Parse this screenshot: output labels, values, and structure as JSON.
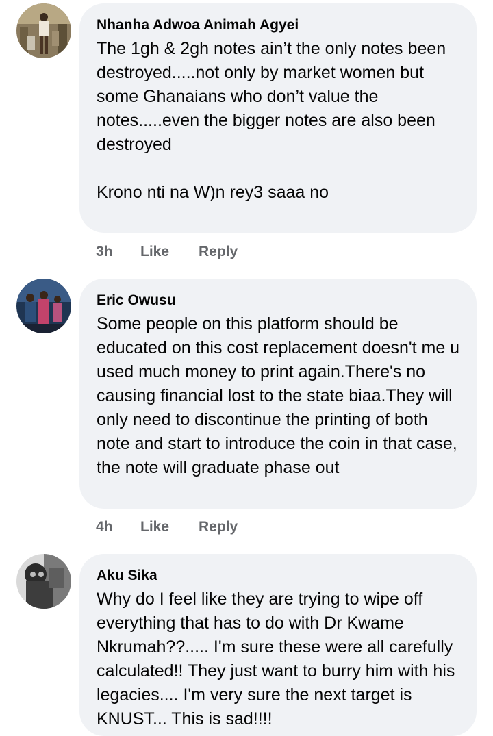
{
  "comments": [
    {
      "author": "Nhanha Adwoa Animah Agyei",
      "text": "The 1gh & 2gh notes ain’t the only notes been destroyed.....not only by market women but some Ghanaians who don’t value the notes.....even the bigger notes are also been destroyed\n\nKrono nti na W)n rey3 saaa no",
      "time": "3h",
      "like_label": "Like",
      "reply_label": "Reply"
    },
    {
      "author": "Eric Owusu",
      "text": "Some people on this platform should be educated on this cost replacement doesn't me u used much money to print again.There's no causing financial lost to the state biaa.They will only need to discontinue the printing of both note and start to introduce the coin in that case, the note will graduate phase out",
      "time": "4h",
      "like_label": "Like",
      "reply_label": "Reply"
    },
    {
      "author": "Aku Sika",
      "text": "Why do I feel like they are trying to wipe off everything that has to do with Dr Kwame Nkrumah??..... I'm sure these were all carefully calculated!!  They just want to burry him with his legacies.... I'm very sure the next target is KNUST... This is sad!!!!",
      "time": "",
      "like_label": "",
      "reply_label": ""
    }
  ],
  "colors": {
    "bubble_bg": "#f0f2f5",
    "text": "#050505",
    "meta": "#65676b"
  }
}
